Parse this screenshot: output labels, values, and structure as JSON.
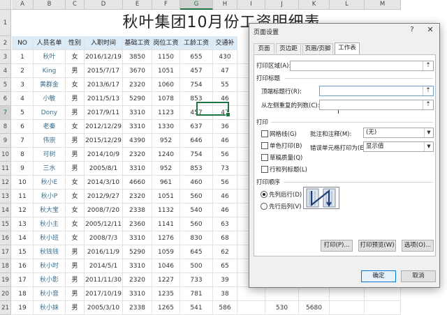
{
  "sheet": {
    "columns": [
      "A",
      "B",
      "C",
      "D",
      "E",
      "F",
      "G",
      "H",
      "I",
      "J",
      "K",
      "L",
      "M"
    ],
    "selected_column": "G",
    "title": "秋叶集团10月份工资明细表",
    "header": [
      "NO",
      "人员名单",
      "性别",
      "入职时间",
      "基础工资",
      "岗位工资",
      "工龄工资",
      "交通补"
    ],
    "rows": [
      {
        "r": "3",
        "no": "1",
        "name": "秋叶",
        "sex": "女",
        "date": "2016/12/19",
        "base": "3850",
        "post": "1150",
        "seniority": "655",
        "traffic": "430"
      },
      {
        "r": "4",
        "no": "2",
        "name": "King",
        "sex": "男",
        "date": "2015/7/17",
        "base": "3670",
        "post": "1051",
        "seniority": "457",
        "traffic": "47"
      },
      {
        "r": "5",
        "no": "3",
        "name": "黄群金",
        "sex": "女",
        "date": "2013/6/17",
        "base": "2320",
        "post": "1060",
        "seniority": "754",
        "traffic": "55"
      },
      {
        "r": "6",
        "no": "4",
        "name": "小敏",
        "sex": "男",
        "date": "2011/5/13",
        "base": "5290",
        "post": "1078",
        "seniority": "853",
        "traffic": "46"
      },
      {
        "r": "7",
        "no": "5",
        "name": "Dony",
        "sex": "男",
        "date": "2017/9/11",
        "base": "3310",
        "post": "1123",
        "seniority": "457",
        "traffic": "47"
      },
      {
        "r": "8",
        "no": "6",
        "name": "老秦",
        "sex": "女",
        "date": "2012/12/29",
        "base": "3310",
        "post": "1330",
        "seniority": "637",
        "traffic": "36"
      },
      {
        "r": "9",
        "no": "7",
        "name": "伟崇",
        "sex": "男",
        "date": "2015/12/29",
        "base": "4390",
        "post": "952",
        "seniority": "646",
        "traffic": "46"
      },
      {
        "r": "10",
        "no": "8",
        "name": "可树",
        "sex": "男",
        "date": "2014/10/9",
        "base": "2320",
        "post": "1240",
        "seniority": "754",
        "traffic": "56"
      },
      {
        "r": "11",
        "no": "9",
        "name": "三水",
        "sex": "男",
        "date": "2005/8/1",
        "base": "3310",
        "post": "952",
        "seniority": "853",
        "traffic": "73"
      },
      {
        "r": "12",
        "no": "10",
        "name": "秋小E",
        "sex": "女",
        "date": "2014/3/10",
        "base": "4660",
        "post": "961",
        "seniority": "460",
        "traffic": "56"
      },
      {
        "r": "13",
        "no": "11",
        "name": "秋小P",
        "sex": "女",
        "date": "2012/9/27",
        "base": "2320",
        "post": "1051",
        "seniority": "560",
        "traffic": "46"
      },
      {
        "r": "14",
        "no": "12",
        "name": "秋大宝",
        "sex": "女",
        "date": "2008/7/20",
        "base": "2338",
        "post": "1132",
        "seniority": "540",
        "traffic": "46"
      },
      {
        "r": "15",
        "no": "13",
        "name": "秋小主",
        "sex": "女",
        "date": "2005/12/11",
        "base": "2360",
        "post": "1141",
        "seniority": "560",
        "traffic": "63"
      },
      {
        "r": "16",
        "no": "14",
        "name": "秋小班",
        "sex": "女",
        "date": "2008/7/3",
        "base": "3310",
        "post": "1276",
        "seniority": "830",
        "traffic": "68"
      },
      {
        "r": "17",
        "no": "15",
        "name": "秋钱钱",
        "sex": "男",
        "date": "2016/11/9",
        "base": "5290",
        "post": "1059",
        "seniority": "645",
        "traffic": "62"
      },
      {
        "r": "18",
        "no": "16",
        "name": "秋小时",
        "sex": "男",
        "date": "2014/5/1",
        "base": "3310",
        "post": "1046",
        "seniority": "500",
        "traffic": "65"
      },
      {
        "r": "19",
        "no": "17",
        "name": "秋小影",
        "sex": "男",
        "date": "2011/11/30",
        "base": "2320",
        "post": "1227",
        "seniority": "733",
        "traffic": "39"
      },
      {
        "r": "20",
        "no": "18",
        "name": "秋小音",
        "sex": "男",
        "date": "2017/10/19",
        "base": "3310",
        "post": "1235",
        "seniority": "781",
        "traffic": "38"
      },
      {
        "r": "21",
        "no": "19",
        "name": "秋小妹",
        "sex": "男",
        "date": "2005/3/10",
        "base": "2338",
        "post": "1265",
        "seniority": "541",
        "traffic": "586"
      }
    ],
    "extra_last_row": [
      "530",
      "5680"
    ]
  },
  "dialog": {
    "title": "页面设置",
    "help": "?",
    "close": "✕",
    "tabs": [
      "页面",
      "页边距",
      "页眉/页脚",
      "工作表"
    ],
    "print_area_label": "打印区域(A):",
    "print_titles_section": "打印标题",
    "top_rows_label": "顶端标题行(R):",
    "left_cols_label": "从左侧重复的列数(C):",
    "print_section": "打印",
    "checks": {
      "gridlines": "网格线(G)",
      "mono": "单色打印(B)",
      "draft": "草稿质量(Q)",
      "row_col_headings": "行和列标题(L)"
    },
    "comments_label": "批注和注释(M):",
    "comments_value": "(无)",
    "errors_label": "错误单元格打印为(E):",
    "errors_value": "显示值",
    "order_section": "打印顺序",
    "order_down": "先列后行(D)",
    "order_over": "先行后列(V)",
    "btn_print": "打印(P)...",
    "btn_preview": "打印预览(W)",
    "btn_options": "选项(O)...",
    "btn_ok": "确定",
    "btn_cancel": "取消"
  }
}
